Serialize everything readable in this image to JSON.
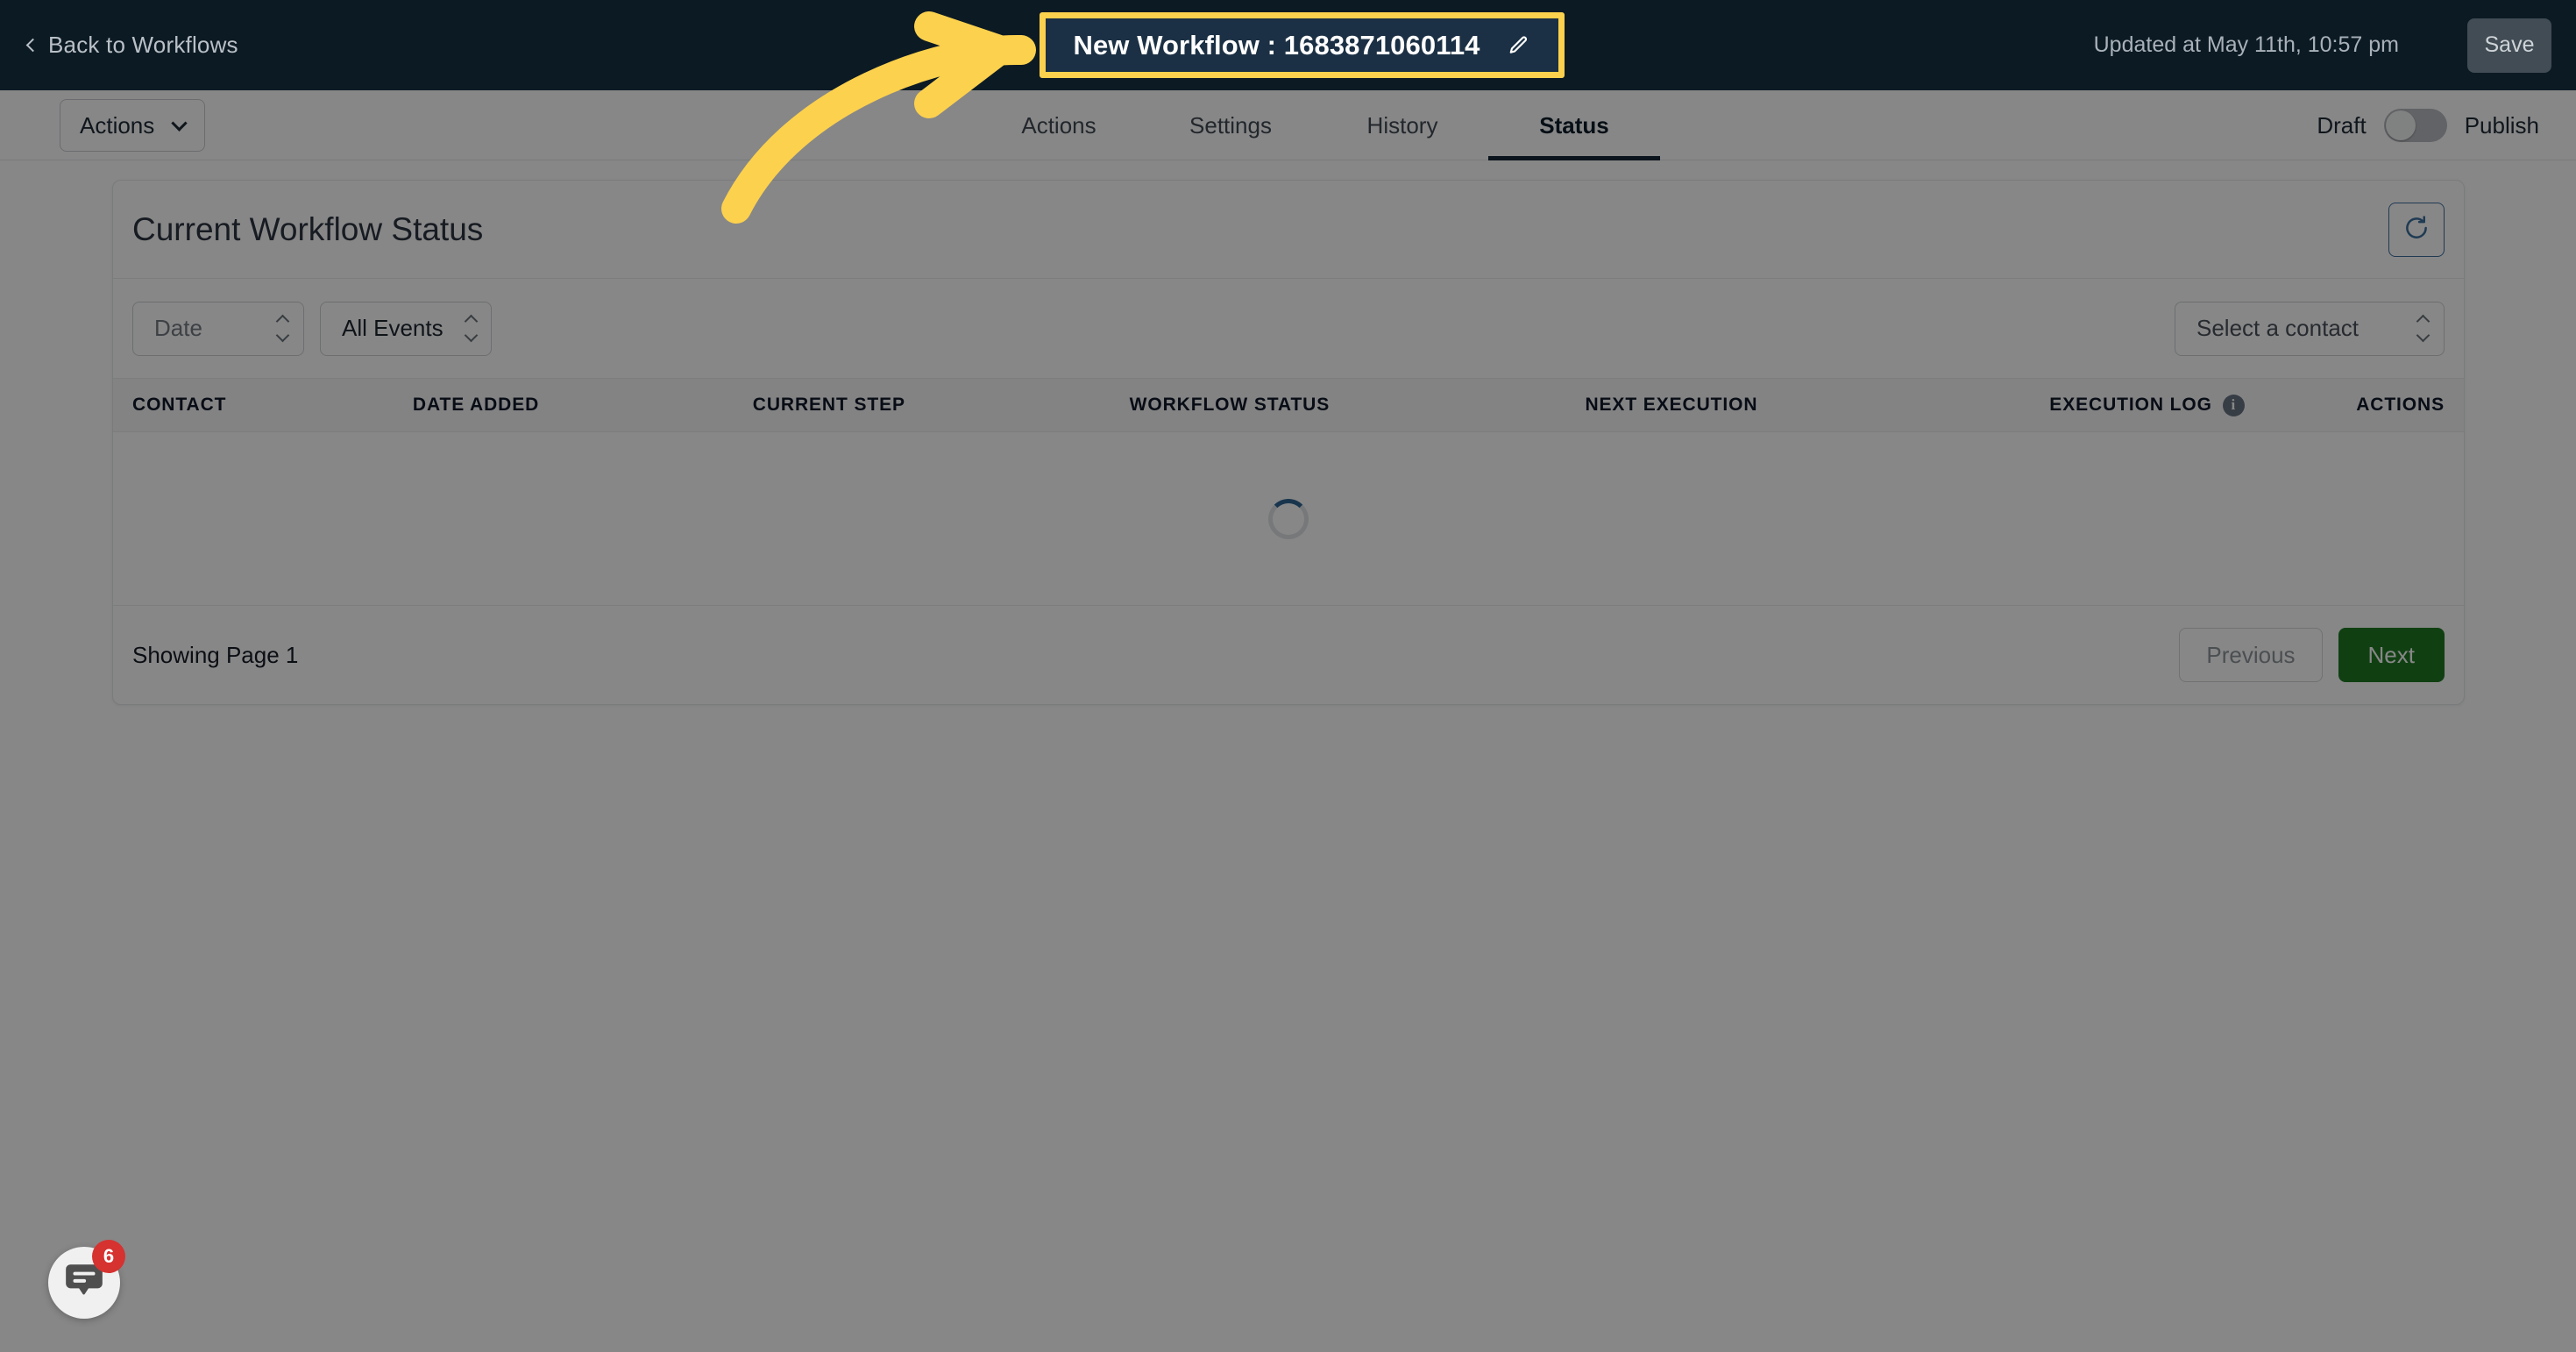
{
  "topbar": {
    "back_label": "Back to Workflows",
    "workflow_title": "New Workflow : 1683871060114",
    "edit_icon": "pencil-icon",
    "updated_text": "Updated at May 11th, 10:57 pm",
    "save_label": "Save",
    "highlight_color": "#fcd14d",
    "bg_color": "#0c1a24"
  },
  "tabbar": {
    "actions_dropdown_label": "Actions",
    "tabs": [
      {
        "label": "Actions",
        "active": false
      },
      {
        "label": "Settings",
        "active": false
      },
      {
        "label": "History",
        "active": false
      },
      {
        "label": "Status",
        "active": true
      }
    ],
    "draft_label": "Draft",
    "publish_label": "Publish",
    "toggle_state": "draft"
  },
  "main": {
    "card_title": "Current Workflow Status",
    "refresh_icon": "refresh-icon",
    "filters": {
      "date_value": "Date",
      "events_value": "All Events",
      "contact_value": "Select a contact"
    },
    "table": {
      "columns": [
        "CONTACT",
        "DATE ADDED",
        "CURRENT STEP",
        "WORKFLOW STATUS",
        "NEXT EXECUTION",
        "EXECUTION LOG",
        "ACTIONS"
      ],
      "execution_log_info_icon": "info-icon",
      "rows": [],
      "loading": true
    },
    "footer": {
      "showing_text": "Showing Page 1",
      "previous_label": "Previous",
      "next_label": "Next",
      "next_color": "#1f7a22"
    }
  },
  "chat_widget": {
    "icon": "chat-bubble-icon",
    "badge_count": "6",
    "badge_color": "#d63230"
  },
  "annotation": {
    "arrow_color": "#fcd14d",
    "arrow_icon": "curved-arrow-right-icon"
  }
}
